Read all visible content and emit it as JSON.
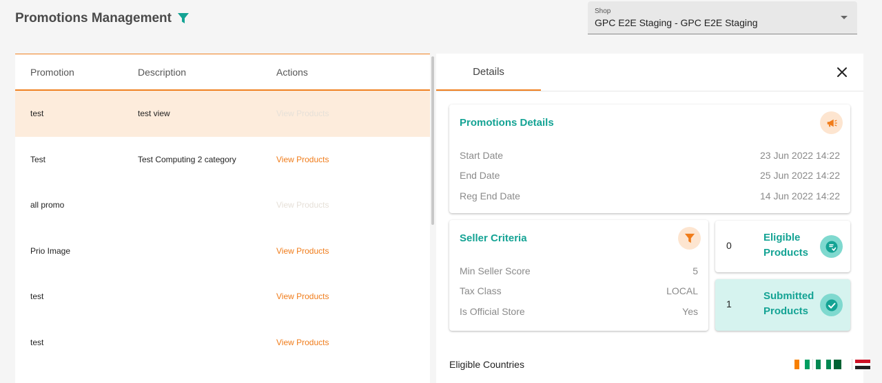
{
  "header": {
    "title": "Promotions Management"
  },
  "shop": {
    "label": "Shop",
    "value": "GPC E2E Staging - GPC E2E Staging"
  },
  "table": {
    "columns": [
      "Promotion",
      "Description",
      "Actions"
    ],
    "rows": [
      {
        "promotion": "test",
        "description": "test view",
        "action": "View Products",
        "action_enabled": false,
        "selected": true
      },
      {
        "promotion": "Test",
        "description": "Test Computing 2 category",
        "action": "View Products",
        "action_enabled": true,
        "selected": false
      },
      {
        "promotion": "all promo",
        "description": "",
        "action": "View Products",
        "action_enabled": false,
        "selected": false
      },
      {
        "promotion": "Prio Image",
        "description": "",
        "action": "View Products",
        "action_enabled": true,
        "selected": false
      },
      {
        "promotion": "test",
        "description": "",
        "action": "View Products",
        "action_enabled": true,
        "selected": false
      },
      {
        "promotion": "test",
        "description": "",
        "action": "View Products",
        "action_enabled": true,
        "selected": false
      }
    ]
  },
  "details": {
    "tab_label": "Details",
    "promotion_details": {
      "title": "Promotions Details",
      "icon": "megaphone-icon",
      "fields": [
        {
          "label": "Start Date",
          "value": "23 Jun 2022 14:22"
        },
        {
          "label": "End Date",
          "value": "25 Jun 2022 14:22"
        },
        {
          "label": "Reg End Date",
          "value": "14 Jun 2022 14:22"
        }
      ]
    },
    "seller_criteria": {
      "title": "Seller Criteria",
      "icon": "filter-icon",
      "fields": [
        {
          "label": "Min Seller Score",
          "value": "5"
        },
        {
          "label": "Tax Class",
          "value": "LOCAL"
        },
        {
          "label": "Is Official Store",
          "value": "Yes"
        }
      ]
    },
    "eligible_products": {
      "count": "0",
      "label": "Eligible Products",
      "icon": "product-swap-icon"
    },
    "submitted_products": {
      "count": "1",
      "label": "Submitted Products",
      "icon": "check-circle-icon"
    },
    "eligible_countries": {
      "label": "Eligible Countries",
      "flags": [
        "flag-ivory-coast-icon",
        "flag-nigeria-icon",
        "flag-algeria-icon",
        "flag-egypt-icon"
      ]
    }
  },
  "colors": {
    "accent": "#f08020",
    "teal": "#14a394",
    "selected_row": "#fdecdc",
    "submitted_bg": "#d6f3ef"
  }
}
